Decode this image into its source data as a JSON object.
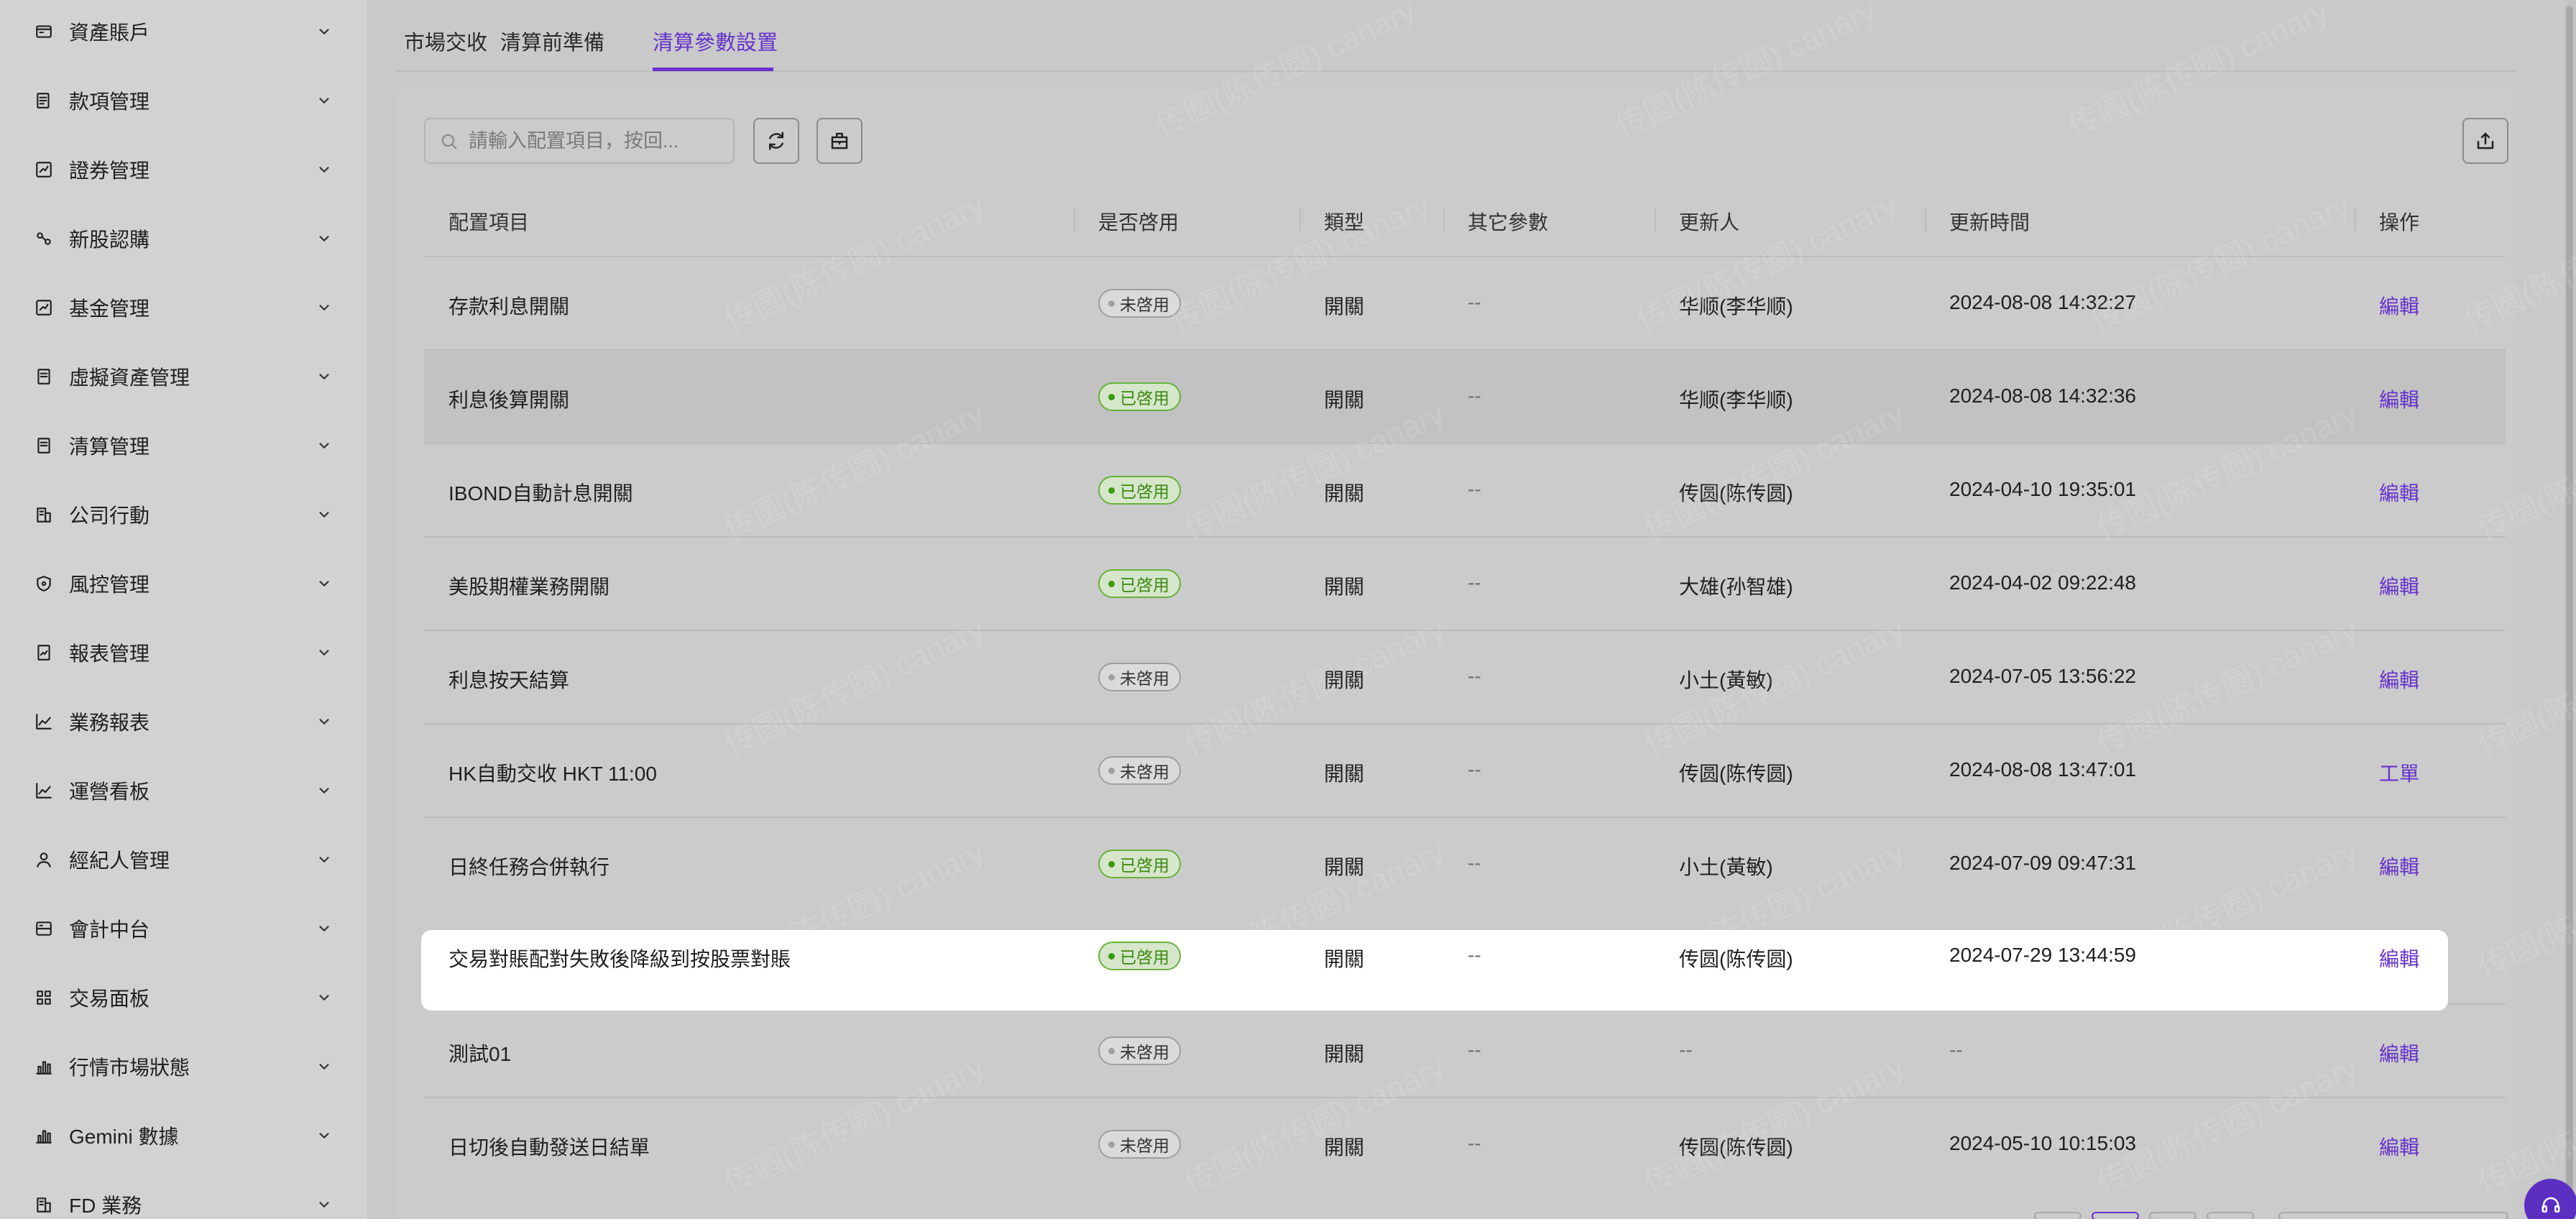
{
  "sidebar": {
    "items": [
      {
        "label": "資產賬戶",
        "icon": "wallet-icon"
      },
      {
        "label": "款項管理",
        "icon": "list-icon"
      },
      {
        "label": "證券管理",
        "icon": "chart-box-icon"
      },
      {
        "label": "新股認購",
        "icon": "link-icon"
      },
      {
        "label": "基金管理",
        "icon": "chart-box-icon"
      },
      {
        "label": "虛擬資產管理",
        "icon": "document-icon"
      },
      {
        "label": "清算管理",
        "icon": "document-icon"
      },
      {
        "label": "公司行動",
        "icon": "building-icon"
      },
      {
        "label": "風控管理",
        "icon": "shield-icon"
      },
      {
        "label": "報表管理",
        "icon": "report-icon"
      },
      {
        "label": "業務報表",
        "icon": "line-chart-icon"
      },
      {
        "label": "運營看板",
        "icon": "line-chart-icon"
      },
      {
        "label": "經紀人管理",
        "icon": "user-icon"
      },
      {
        "label": "會計中台",
        "icon": "ledger-icon"
      },
      {
        "label": "交易面板",
        "icon": "grid-icon"
      },
      {
        "label": "行情市場狀態",
        "icon": "bar-chart-icon"
      },
      {
        "label": "Gemini 數據",
        "icon": "bar-chart-icon"
      },
      {
        "label": "FD 業務",
        "icon": "building-icon"
      }
    ]
  },
  "tabs": [
    {
      "label": "市場交收"
    },
    {
      "label": "清算前準備"
    },
    {
      "label": "清算參數設置"
    }
  ],
  "toolbar": {
    "search_placeholder": "請輸入配置項目，按回..."
  },
  "table": {
    "headers": [
      "配置項目",
      "是否啓用",
      "類型",
      "其它參數",
      "更新人",
      "更新時間",
      "操作"
    ],
    "rows": [
      {
        "item": "存款利息開關",
        "status": "未啓用",
        "enabled": false,
        "type": "開關",
        "params": "--",
        "updater": "华顺(李华顺)",
        "time": "2024-08-08 14:32:27",
        "action": "編輯"
      },
      {
        "item": "利息後算開關",
        "status": "已啓用",
        "enabled": true,
        "type": "開關",
        "params": "--",
        "updater": "华顺(李华顺)",
        "time": "2024-08-08 14:32:36",
        "action": "編輯"
      },
      {
        "item": "IBOND自動計息開關",
        "status": "已啓用",
        "enabled": true,
        "type": "開關",
        "params": "--",
        "updater": "传圆(陈传圆)",
        "time": "2024-04-10 19:35:01",
        "action": "編輯"
      },
      {
        "item": "美股期權業務開關",
        "status": "已啓用",
        "enabled": true,
        "type": "開關",
        "params": "--",
        "updater": "大雄(孙智雄)",
        "time": "2024-04-02 09:22:48",
        "action": "編輯"
      },
      {
        "item": "利息按天結算",
        "status": "未啓用",
        "enabled": false,
        "type": "開關",
        "params": "--",
        "updater": "小土(黃敏)",
        "time": "2024-07-05 13:56:22",
        "action": "編輯"
      },
      {
        "item": "HK自動交收 HKT 11:00",
        "status": "未啓用",
        "enabled": false,
        "type": "開關",
        "params": "--",
        "updater": "传圆(陈传圆)",
        "time": "2024-08-08 13:47:01",
        "action": "工單"
      },
      {
        "item": "日終任務合併執行",
        "status": "已啓用",
        "enabled": true,
        "type": "開關",
        "params": "--",
        "updater": "小土(黃敏)",
        "time": "2024-07-09 09:47:31",
        "action": "編輯"
      },
      {
        "item": "交易對賬配對失敗後降級到按股票對賬",
        "status": "已啓用",
        "enabled": true,
        "type": "開關",
        "params": "--",
        "updater": "传圆(陈传圆)",
        "time": "2024-07-29 13:44:59",
        "action": "編輯"
      },
      {
        "item": "測試01",
        "status": "未啓用",
        "enabled": false,
        "type": "開關",
        "params": "--",
        "updater": "--",
        "time": "--",
        "action": "編輯"
      },
      {
        "item": "日切後自動發送日結單",
        "status": "未啓用",
        "enabled": false,
        "type": "開關",
        "params": "--",
        "updater": "传圆(陈传圆)",
        "time": "2024-05-10 10:15:03",
        "action": "編輯"
      }
    ]
  },
  "watermark": "传圆(陈传圆) canary",
  "colors": {
    "accent": "#6633cc",
    "enabled": "#3a9a10"
  }
}
